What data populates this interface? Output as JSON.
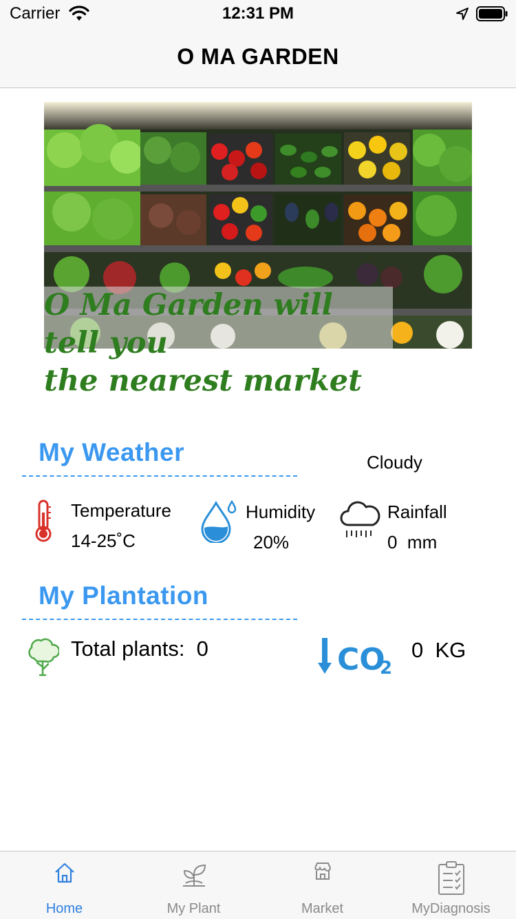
{
  "status_bar": {
    "carrier": "Carrier",
    "time": "12:31 PM"
  },
  "nav": {
    "title": "O MA GARDEN"
  },
  "banner": {
    "caption_lines": [
      "O Ma Garden will",
      "tell you",
      "the nearest market"
    ]
  },
  "weather": {
    "heading": "My  Weather",
    "condition": "Cloudy",
    "temperature": {
      "label": "Temperature",
      "value": "14-25˚C",
      "icon": "thermometer-icon"
    },
    "humidity": {
      "label": "Humidity",
      "value": "20%",
      "icon": "water-drop-icon"
    },
    "rainfall": {
      "label": "Rainfall",
      "value": "0  mm",
      "icon": "rain-cloud-icon"
    }
  },
  "plantation": {
    "heading": "My  Plantation",
    "total_plants": "Total plants:  0",
    "co2_value": "0  KG",
    "co2_icon_text": "CO",
    "co2_icon_sub": "2"
  },
  "tabs": [
    {
      "label": "Home",
      "icon": "home-icon",
      "active": true
    },
    {
      "label": "My Plant",
      "icon": "seedling-icon",
      "active": false
    },
    {
      "label": "Market",
      "icon": "store-icon",
      "active": false
    },
    {
      "label": "MyDiagnosis",
      "icon": "clipboard-icon",
      "active": false
    }
  ],
  "colors": {
    "accent": "#3b98f0",
    "active_tab": "#2f7fe0",
    "inactive_tab": "#8a8a8a",
    "caption_green": "#2e7d1e"
  }
}
